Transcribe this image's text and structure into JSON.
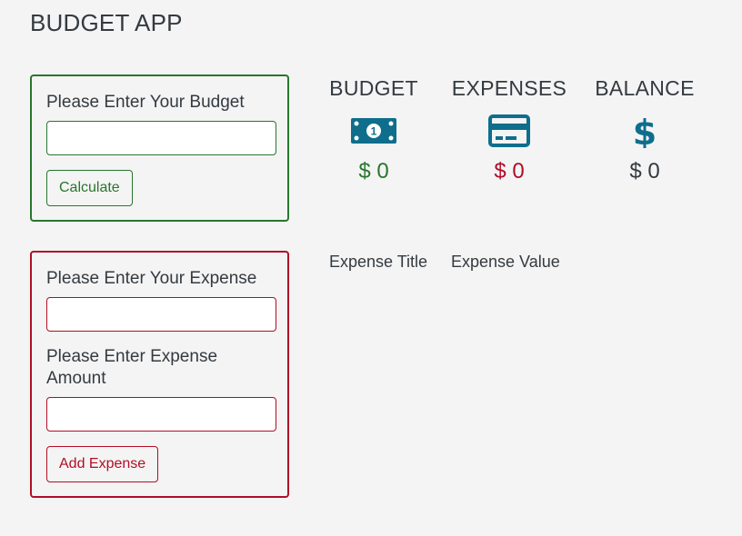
{
  "app": {
    "title": "BUDGET APP"
  },
  "budget_form": {
    "label": "Please Enter Your Budget",
    "input_value": "",
    "submit_label": "Calculate"
  },
  "expense_form": {
    "title_label": "Please Enter Your Expense",
    "title_value": "",
    "amount_label": "Please Enter Expense Amount",
    "amount_value": "",
    "submit_label": "Add Expense"
  },
  "summary": {
    "budget": {
      "label": "BUDGET",
      "icon": "money-bill-icon",
      "amount": "$ 0",
      "color": "#28762e"
    },
    "expenses": {
      "label": "EXPENSES",
      "icon": "credit-card-icon",
      "amount": "$ 0",
      "color": "#b00e25"
    },
    "balance": {
      "label": "BALANCE",
      "icon": "dollar-sign-icon",
      "amount": "$ 0",
      "color": "#343a40"
    }
  },
  "expense_list": {
    "columns": [
      "Expense Title",
      "Expense Value"
    ],
    "rows": []
  },
  "colors": {
    "accent_green": "#28762e",
    "accent_red": "#b00e25",
    "icon_blue": "#0e6e8c",
    "background": "#f4f4f4"
  }
}
